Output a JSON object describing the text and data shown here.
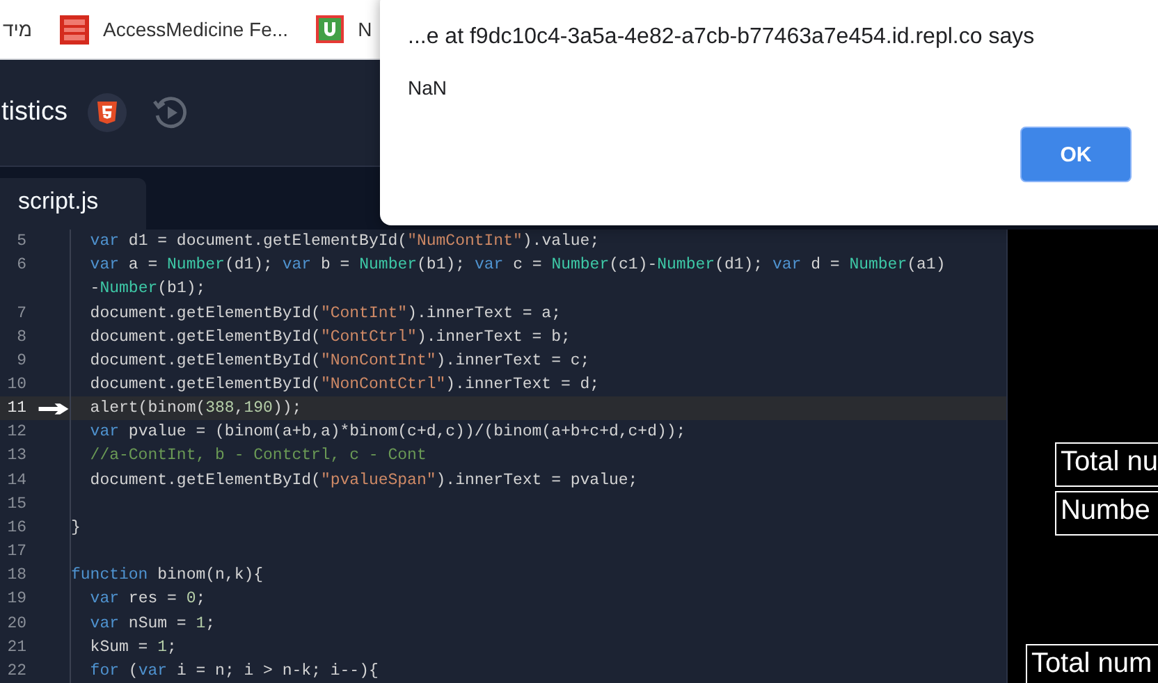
{
  "bookmarks": [
    {
      "label": "מיד",
      "kind": "text"
    },
    {
      "label": "AccessMedicine Fe...",
      "kind": "mcgraw"
    },
    {
      "label": "N",
      "kind": "u"
    }
  ],
  "header": {
    "title": "tistics"
  },
  "tabs": [
    {
      "label": "script.js",
      "selected": true
    }
  ],
  "editor": {
    "lines": [
      {
        "number": "5",
        "current": false,
        "tokens": [
          {
            "kind": "keyword",
            "text": "  var"
          },
          {
            "kind": "plain",
            "text": " d1 = document.getElementById("
          },
          {
            "kind": "string",
            "text": "\"NumContInt\""
          },
          {
            "kind": "plain",
            "text": ").value;"
          }
        ]
      },
      {
        "number": "6",
        "current": false,
        "tokens": [
          {
            "kind": "keyword",
            "text": "  var"
          },
          {
            "kind": "plain",
            "text": " a = "
          },
          {
            "kind": "func",
            "text": "Number"
          },
          {
            "kind": "plain",
            "text": "(d1); "
          },
          {
            "kind": "keyword",
            "text": "var"
          },
          {
            "kind": "plain",
            "text": " b = "
          },
          {
            "kind": "func",
            "text": "Number"
          },
          {
            "kind": "plain",
            "text": "(b1); "
          },
          {
            "kind": "keyword",
            "text": "var"
          },
          {
            "kind": "plain",
            "text": " c = "
          },
          {
            "kind": "func",
            "text": "Number"
          },
          {
            "kind": "plain",
            "text": "(c1)-"
          },
          {
            "kind": "func",
            "text": "Number"
          },
          {
            "kind": "plain",
            "text": "(d1); "
          },
          {
            "kind": "keyword",
            "text": "var"
          },
          {
            "kind": "plain",
            "text": " d = "
          },
          {
            "kind": "func",
            "text": "Number"
          },
          {
            "kind": "plain",
            "text": "(a1)"
          }
        ],
        "continuation": [
          {
            "kind": "plain",
            "text": "  -"
          },
          {
            "kind": "func",
            "text": "Number"
          },
          {
            "kind": "plain",
            "text": "(b1);"
          }
        ]
      },
      {
        "number": "7",
        "current": false,
        "tokens": [
          {
            "kind": "plain",
            "text": "  document.getElementById("
          },
          {
            "kind": "string",
            "text": "\"ContInt\""
          },
          {
            "kind": "plain",
            "text": ").innerText = a;"
          }
        ]
      },
      {
        "number": "8",
        "current": false,
        "tokens": [
          {
            "kind": "plain",
            "text": "  document.getElementById("
          },
          {
            "kind": "string",
            "text": "\"ContCtrl\""
          },
          {
            "kind": "plain",
            "text": ").innerText = b;"
          }
        ]
      },
      {
        "number": "9",
        "current": false,
        "tokens": [
          {
            "kind": "plain",
            "text": "  document.getElementById("
          },
          {
            "kind": "string",
            "text": "\"NonContInt\""
          },
          {
            "kind": "plain",
            "text": ").innerText = c;"
          }
        ]
      },
      {
        "number": "10",
        "current": false,
        "tokens": [
          {
            "kind": "plain",
            "text": "  document.getElementById("
          },
          {
            "kind": "string",
            "text": "\"NonContCtrl\""
          },
          {
            "kind": "plain",
            "text": ").innerText = d;"
          }
        ]
      },
      {
        "number": "11",
        "current": true,
        "tokens": [
          {
            "kind": "plain",
            "text": "  alert(binom("
          },
          {
            "kind": "number",
            "text": "388"
          },
          {
            "kind": "plain",
            "text": ","
          },
          {
            "kind": "number",
            "text": "190"
          },
          {
            "kind": "plain",
            "text": "));"
          }
        ]
      },
      {
        "number": "12",
        "current": false,
        "tokens": [
          {
            "kind": "keyword",
            "text": "  var"
          },
          {
            "kind": "plain",
            "text": " pvalue = (binom(a+b,a)*binom(c+d,c))/(binom(a+b+c+d,c+d));"
          }
        ]
      },
      {
        "number": "13",
        "current": false,
        "tokens": [
          {
            "kind": "comment",
            "text": "  //a-ContInt, b - Contctrl, c - Cont"
          }
        ]
      },
      {
        "number": "14",
        "current": false,
        "tokens": [
          {
            "kind": "plain",
            "text": "  document.getElementById("
          },
          {
            "kind": "string",
            "text": "\"pvalueSpan\""
          },
          {
            "kind": "plain",
            "text": ").innerText = pvalue;"
          }
        ]
      },
      {
        "number": "15",
        "current": false
      },
      {
        "number": "16",
        "current": false,
        "tokens": [
          {
            "kind": "plain",
            "text": "}"
          }
        ]
      },
      {
        "number": "17",
        "current": false
      },
      {
        "number": "18",
        "current": false,
        "tokens": [
          {
            "kind": "keyword",
            "text": "function"
          },
          {
            "kind": "plain",
            "text": " binom(n,k){"
          }
        ]
      },
      {
        "number": "19",
        "current": false,
        "tokens": [
          {
            "kind": "keyword",
            "text": "  var"
          },
          {
            "kind": "plain",
            "text": " res = "
          },
          {
            "kind": "number",
            "text": "0"
          },
          {
            "kind": "plain",
            "text": ";"
          }
        ]
      },
      {
        "number": "20",
        "current": false,
        "tokens": [
          {
            "kind": "keyword",
            "text": "  var"
          },
          {
            "kind": "plain",
            "text": " nSum = "
          },
          {
            "kind": "number",
            "text": "1"
          },
          {
            "kind": "plain",
            "text": ";"
          }
        ]
      },
      {
        "number": "21",
        "current": false,
        "tokens": [
          {
            "kind": "plain",
            "text": "  kSum = "
          },
          {
            "kind": "number",
            "text": "1"
          },
          {
            "kind": "plain",
            "text": ";"
          }
        ]
      },
      {
        "number": "22",
        "current": false,
        "tokens": [
          {
            "kind": "keyword",
            "text": "  for"
          },
          {
            "kind": "plain",
            "text": " ("
          },
          {
            "kind": "keyword",
            "text": "var"
          },
          {
            "kind": "plain",
            "text": " i = n; i > n-k; i--){"
          }
        ]
      }
    ]
  },
  "preview": {
    "cells": [
      {
        "text": "Total nu",
        "kind": "box"
      },
      {
        "text": "Numbe",
        "kind": "box"
      },
      {
        "text": "Total num",
        "kind": "bottom"
      }
    ]
  },
  "dialog": {
    "title": "...e at f9dc10c4-3a5a-4e82-a7cb-b77463a7e454.id.repl.co says",
    "message": "NaN",
    "button": "OK"
  }
}
